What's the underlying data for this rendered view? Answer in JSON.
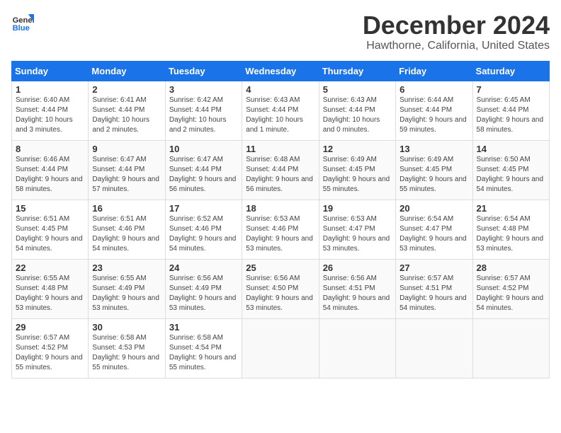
{
  "logo": {
    "line1": "General",
    "line2": "Blue"
  },
  "title": "December 2024",
  "subtitle": "Hawthorne, California, United States",
  "days_of_week": [
    "Sunday",
    "Monday",
    "Tuesday",
    "Wednesday",
    "Thursday",
    "Friday",
    "Saturday"
  ],
  "weeks": [
    [
      {
        "num": "1",
        "sunrise": "6:40 AM",
        "sunset": "4:44 PM",
        "daylight": "10 hours and 3 minutes."
      },
      {
        "num": "2",
        "sunrise": "6:41 AM",
        "sunset": "4:44 PM",
        "daylight": "10 hours and 2 minutes."
      },
      {
        "num": "3",
        "sunrise": "6:42 AM",
        "sunset": "4:44 PM",
        "daylight": "10 hours and 2 minutes."
      },
      {
        "num": "4",
        "sunrise": "6:43 AM",
        "sunset": "4:44 PM",
        "daylight": "10 hours and 1 minute."
      },
      {
        "num": "5",
        "sunrise": "6:43 AM",
        "sunset": "4:44 PM",
        "daylight": "10 hours and 0 minutes."
      },
      {
        "num": "6",
        "sunrise": "6:44 AM",
        "sunset": "4:44 PM",
        "daylight": "9 hours and 59 minutes."
      },
      {
        "num": "7",
        "sunrise": "6:45 AM",
        "sunset": "4:44 PM",
        "daylight": "9 hours and 58 minutes."
      }
    ],
    [
      {
        "num": "8",
        "sunrise": "6:46 AM",
        "sunset": "4:44 PM",
        "daylight": "9 hours and 58 minutes."
      },
      {
        "num": "9",
        "sunrise": "6:47 AM",
        "sunset": "4:44 PM",
        "daylight": "9 hours and 57 minutes."
      },
      {
        "num": "10",
        "sunrise": "6:47 AM",
        "sunset": "4:44 PM",
        "daylight": "9 hours and 56 minutes."
      },
      {
        "num": "11",
        "sunrise": "6:48 AM",
        "sunset": "4:44 PM",
        "daylight": "9 hours and 56 minutes."
      },
      {
        "num": "12",
        "sunrise": "6:49 AM",
        "sunset": "4:45 PM",
        "daylight": "9 hours and 55 minutes."
      },
      {
        "num": "13",
        "sunrise": "6:49 AM",
        "sunset": "4:45 PM",
        "daylight": "9 hours and 55 minutes."
      },
      {
        "num": "14",
        "sunrise": "6:50 AM",
        "sunset": "4:45 PM",
        "daylight": "9 hours and 54 minutes."
      }
    ],
    [
      {
        "num": "15",
        "sunrise": "6:51 AM",
        "sunset": "4:45 PM",
        "daylight": "9 hours and 54 minutes."
      },
      {
        "num": "16",
        "sunrise": "6:51 AM",
        "sunset": "4:46 PM",
        "daylight": "9 hours and 54 minutes."
      },
      {
        "num": "17",
        "sunrise": "6:52 AM",
        "sunset": "4:46 PM",
        "daylight": "9 hours and 54 minutes."
      },
      {
        "num": "18",
        "sunrise": "6:53 AM",
        "sunset": "4:46 PM",
        "daylight": "9 hours and 53 minutes."
      },
      {
        "num": "19",
        "sunrise": "6:53 AM",
        "sunset": "4:47 PM",
        "daylight": "9 hours and 53 minutes."
      },
      {
        "num": "20",
        "sunrise": "6:54 AM",
        "sunset": "4:47 PM",
        "daylight": "9 hours and 53 minutes."
      },
      {
        "num": "21",
        "sunrise": "6:54 AM",
        "sunset": "4:48 PM",
        "daylight": "9 hours and 53 minutes."
      }
    ],
    [
      {
        "num": "22",
        "sunrise": "6:55 AM",
        "sunset": "4:48 PM",
        "daylight": "9 hours and 53 minutes."
      },
      {
        "num": "23",
        "sunrise": "6:55 AM",
        "sunset": "4:49 PM",
        "daylight": "9 hours and 53 minutes."
      },
      {
        "num": "24",
        "sunrise": "6:56 AM",
        "sunset": "4:49 PM",
        "daylight": "9 hours and 53 minutes."
      },
      {
        "num": "25",
        "sunrise": "6:56 AM",
        "sunset": "4:50 PM",
        "daylight": "9 hours and 53 minutes."
      },
      {
        "num": "26",
        "sunrise": "6:56 AM",
        "sunset": "4:51 PM",
        "daylight": "9 hours and 54 minutes."
      },
      {
        "num": "27",
        "sunrise": "6:57 AM",
        "sunset": "4:51 PM",
        "daylight": "9 hours and 54 minutes."
      },
      {
        "num": "28",
        "sunrise": "6:57 AM",
        "sunset": "4:52 PM",
        "daylight": "9 hours and 54 minutes."
      }
    ],
    [
      {
        "num": "29",
        "sunrise": "6:57 AM",
        "sunset": "4:52 PM",
        "daylight": "9 hours and 55 minutes."
      },
      {
        "num": "30",
        "sunrise": "6:58 AM",
        "sunset": "4:53 PM",
        "daylight": "9 hours and 55 minutes."
      },
      {
        "num": "31",
        "sunrise": "6:58 AM",
        "sunset": "4:54 PM",
        "daylight": "9 hours and 55 minutes."
      },
      null,
      null,
      null,
      null
    ]
  ],
  "labels": {
    "sunrise": "Sunrise:",
    "sunset": "Sunset:",
    "daylight": "Daylight:"
  }
}
